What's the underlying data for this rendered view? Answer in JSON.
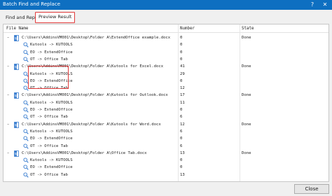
{
  "window": {
    "title": "Batch Find and Replace",
    "help_symbol": "?",
    "close_symbol": "✕"
  },
  "tabs": [
    {
      "label": "Find and Replace"
    },
    {
      "label": "Preview Result"
    }
  ],
  "table": {
    "headers": {
      "file_name": "File Name",
      "number": "Number",
      "state": "State"
    },
    "files": [
      {
        "toggle": "−",
        "path": "C:\\Users\\AddinsVM001\\Desktop\\Folder A\\ExtendOffice example.docx",
        "number": "0",
        "state": "Done",
        "rules": [
          {
            "text": "Kutools -> KUTOOLS",
            "number": "0"
          },
          {
            "text": "EO -> ExtendOffice",
            "number": "0"
          },
          {
            "text": "OT -> Office Tab",
            "number": "0"
          }
        ]
      },
      {
        "toggle": "−",
        "path": "C:\\Users\\AddinsVM001\\Desktop\\Folder A\\Kutools for Excel.docx",
        "number": "41",
        "state": "Done",
        "rules": [
          {
            "text": "Kutools -> KUTOOLS",
            "number": "29"
          },
          {
            "text": "EO -> ExtendOffice",
            "number": "0"
          },
          {
            "text": "OT -> Office Tab",
            "number": "12"
          }
        ]
      },
      {
        "toggle": "−",
        "path": "C:\\Users\\AddinsVM001\\Desktop\\Folder A\\Kutools for Outlook.docx",
        "number": "17",
        "state": "Done",
        "rules": [
          {
            "text": "Kutools -> KUTOOLS",
            "number": "11"
          },
          {
            "text": "EO -> ExtendOffice",
            "number": "0"
          },
          {
            "text": "OT -> Office Tab",
            "number": "6"
          }
        ]
      },
      {
        "toggle": "−",
        "path": "C:\\Users\\AddinsVM001\\Desktop\\Folder A\\Kutools for Word.docx",
        "number": "12",
        "state": "Done",
        "rules": [
          {
            "text": "Kutools -> KUTOOLS",
            "number": "6"
          },
          {
            "text": "EO -> ExtendOffice",
            "number": "0"
          },
          {
            "text": "OT -> Office Tab",
            "number": "6"
          }
        ]
      },
      {
        "toggle": "−",
        "path": "C:\\Users\\AddinsVM001\\Desktop\\Folder A\\Office Tab.docx",
        "number": "13",
        "state": "Done",
        "rules": [
          {
            "text": "Kutools -> KUTOOLS",
            "number": "0"
          },
          {
            "text": "EO -> ExtendOffice",
            "number": "0"
          },
          {
            "text": "OT -> Office Tab",
            "number": "13"
          }
        ]
      }
    ]
  },
  "footer": {
    "close_label": "Close"
  },
  "colors": {
    "titlebar": "#0e6fc1",
    "highlight": "#e03a3a",
    "icon_blue": "#3c7fd0"
  }
}
